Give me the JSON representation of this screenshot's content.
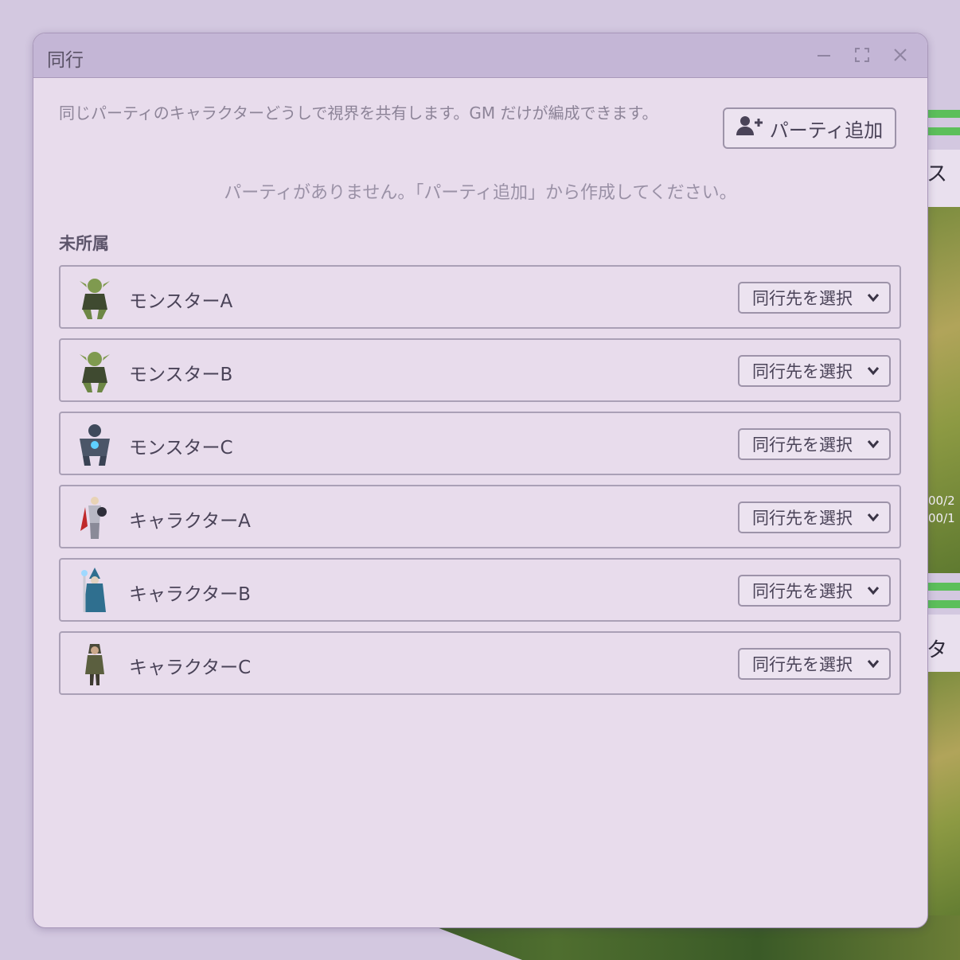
{
  "window": {
    "title": "同行"
  },
  "description": "同じパーティのキャラクターどうしで視界を共有します。GM だけが編成できます。",
  "add_party_button": {
    "label": "パーティ追加",
    "icon": "user-plus-icon"
  },
  "empty_message": "パーティがありません。「パーティ追加」から作成してください。",
  "unassigned": {
    "title": "未所属",
    "items": [
      {
        "name": "モンスターA",
        "avatar": "goblin-icon",
        "select_value": "同行先を選択"
      },
      {
        "name": "モンスターB",
        "avatar": "goblin-icon",
        "select_value": "同行先を選択"
      },
      {
        "name": "モンスターC",
        "avatar": "golem-icon",
        "select_value": "同行先を選択"
      },
      {
        "name": "キャラクターA",
        "avatar": "knight-icon",
        "select_value": "同行先を選択"
      },
      {
        "name": "キャラクターB",
        "avatar": "wizard-icon",
        "select_value": "同行先を選択"
      },
      {
        "name": "キャラクターC",
        "avatar": "ranger-icon",
        "select_value": "同行先を選択"
      }
    ]
  },
  "background": {
    "texts": [
      "ス",
      "タ"
    ],
    "stats": [
      "00/2",
      "00/1"
    ]
  }
}
